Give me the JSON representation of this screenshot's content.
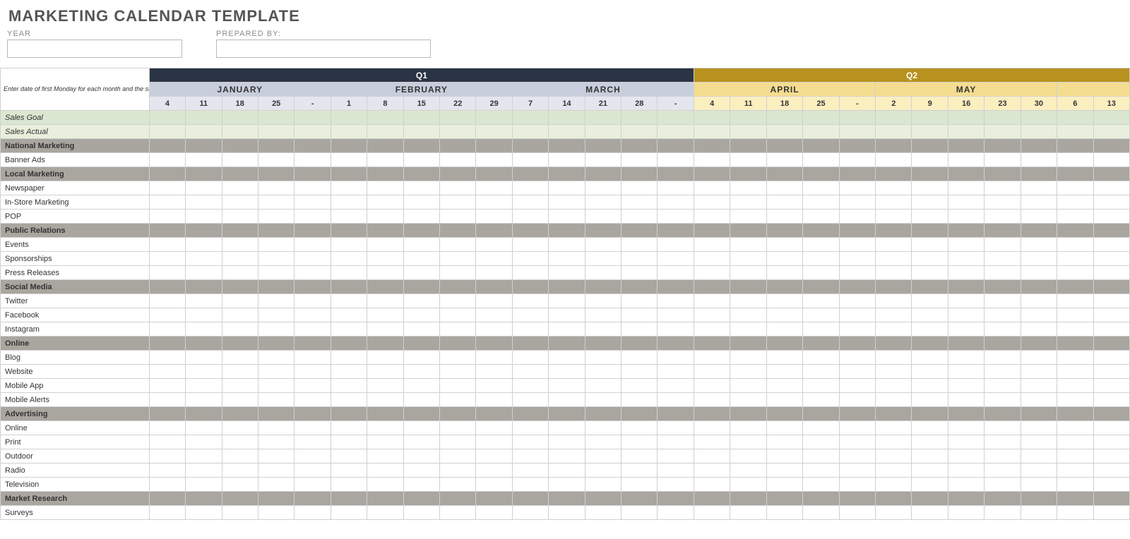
{
  "title": "MARKETING CALENDAR TEMPLATE",
  "meta": {
    "year_label": "YEAR",
    "year_value": "",
    "prepared_label": "PREPARED BY:",
    "prepared_value": ""
  },
  "side_note": "Enter date of first Monday for each month and the subsequent dates will populate.",
  "quarters": [
    {
      "label": "Q1",
      "class": "q1-bg",
      "months": 3
    },
    {
      "label": "Q2",
      "class": "q2-bg",
      "months": 3
    }
  ],
  "months": [
    {
      "label": "JANUARY",
      "weeks": [
        "4",
        "11",
        "18",
        "25",
        "-"
      ],
      "hdr": "m-q1",
      "wk": "w-q1"
    },
    {
      "label": "FEBRUARY",
      "weeks": [
        "1",
        "8",
        "15",
        "22",
        "29"
      ],
      "hdr": "m-q1",
      "wk": "w-q1"
    },
    {
      "label": "MARCH",
      "weeks": [
        "7",
        "14",
        "21",
        "28",
        "-"
      ],
      "hdr": "m-q1",
      "wk": "w-q1"
    },
    {
      "label": "APRIL",
      "weeks": [
        "4",
        "11",
        "18",
        "25",
        "-"
      ],
      "hdr": "m-q2",
      "wk": "w-q2"
    },
    {
      "label": "MAY",
      "weeks": [
        "2",
        "9",
        "16",
        "23",
        "30"
      ],
      "hdr": "m-q2",
      "wk": "w-q2"
    },
    {
      "label": "",
      "weeks": [
        "6",
        "13"
      ],
      "hdr": "m-q2",
      "wk": "w-q2"
    }
  ],
  "sales_rows": [
    {
      "label": "Sales Goal",
      "class": "sales-goal"
    },
    {
      "label": "Sales Actual",
      "class": "sales-actual"
    }
  ],
  "body": [
    {
      "type": "section",
      "label": "National Marketing"
    },
    {
      "type": "item",
      "label": "Banner Ads"
    },
    {
      "type": "section",
      "label": "Local Marketing"
    },
    {
      "type": "item",
      "label": "Newspaper"
    },
    {
      "type": "item",
      "label": "In-Store Marketing"
    },
    {
      "type": "item",
      "label": "POP"
    },
    {
      "type": "section",
      "label": "Public Relations"
    },
    {
      "type": "item",
      "label": "Events"
    },
    {
      "type": "item",
      "label": "Sponsorships"
    },
    {
      "type": "item",
      "label": "Press Releases"
    },
    {
      "type": "section",
      "label": "Social Media"
    },
    {
      "type": "item",
      "label": "Twitter"
    },
    {
      "type": "item",
      "label": "Facebook"
    },
    {
      "type": "item",
      "label": "Instagram"
    },
    {
      "type": "section",
      "label": "Online"
    },
    {
      "type": "item",
      "label": "Blog"
    },
    {
      "type": "item",
      "label": "Website"
    },
    {
      "type": "item",
      "label": "Mobile App"
    },
    {
      "type": "item",
      "label": "Mobile Alerts"
    },
    {
      "type": "section",
      "label": "Advertising"
    },
    {
      "type": "item",
      "label": "Online"
    },
    {
      "type": "item",
      "label": "Print"
    },
    {
      "type": "item",
      "label": "Outdoor"
    },
    {
      "type": "item",
      "label": "Radio"
    },
    {
      "type": "item",
      "label": "Television"
    },
    {
      "type": "section",
      "label": "Market Research"
    },
    {
      "type": "item",
      "label": "Surveys"
    }
  ]
}
